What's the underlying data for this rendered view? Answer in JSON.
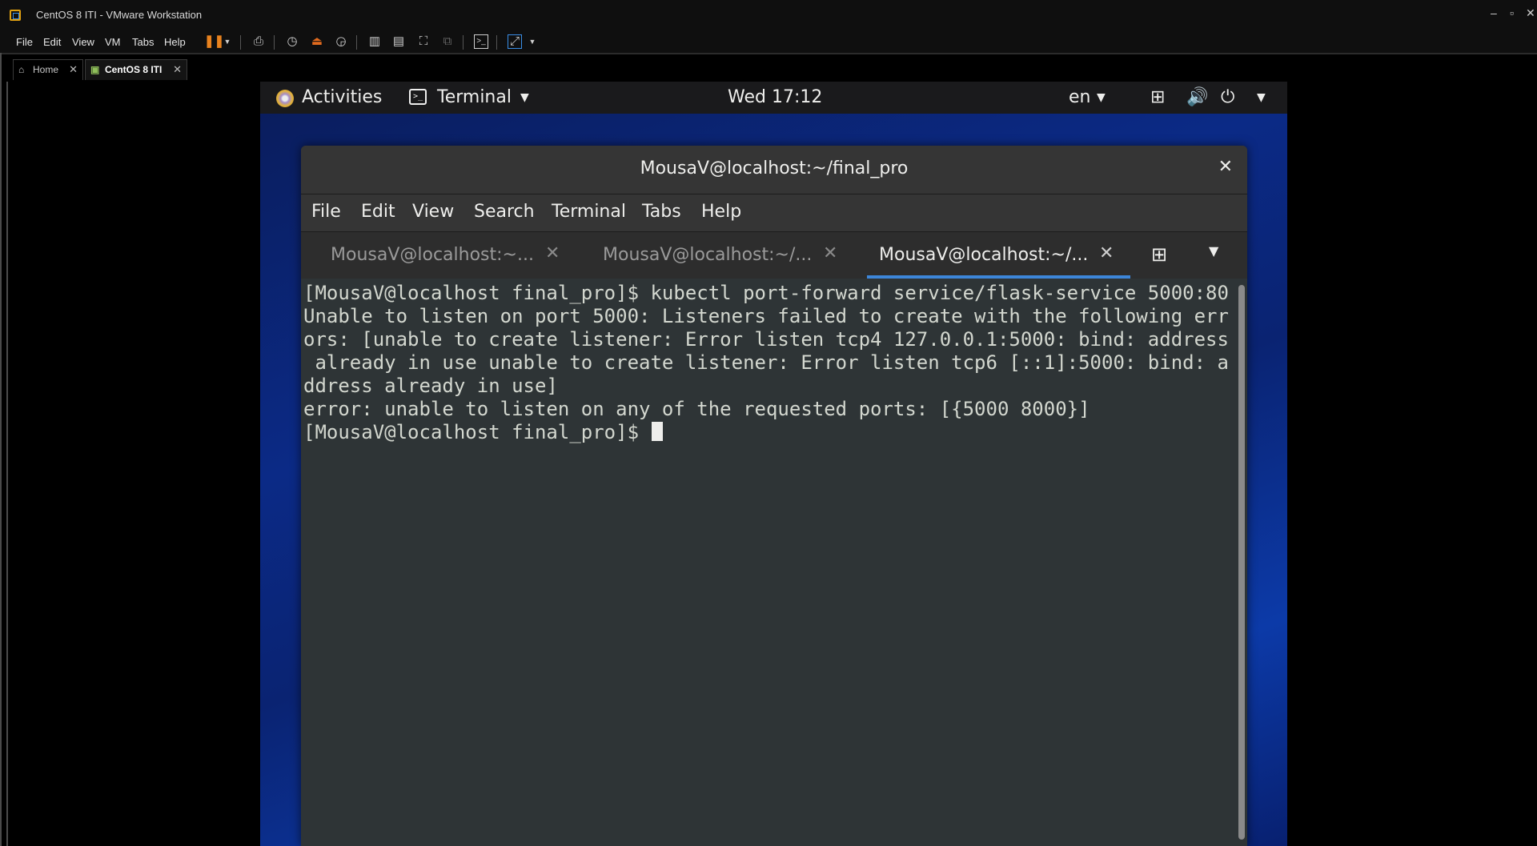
{
  "vmware": {
    "window_title": "CentOS 8 ITI - VMware Workstation",
    "menu": [
      "File",
      "Edit",
      "View",
      "VM",
      "Tabs",
      "Help"
    ],
    "window_controls": {
      "minimize": "–",
      "restore": "▫",
      "close": "✕"
    },
    "tabs": [
      {
        "label": "Home",
        "icon": "home-icon",
        "close": "✕"
      },
      {
        "label": "CentOS 8 ITI",
        "icon": "vm-icon",
        "close": "✕",
        "active": true
      }
    ],
    "accent_color": "#e8821e"
  },
  "gnome": {
    "activities_label": "Activities",
    "app_menu_label": "Terminal",
    "clock": "Wed 17:12",
    "language": "en",
    "status_icons": [
      "network-icon",
      "volume-icon",
      "power-icon"
    ]
  },
  "terminal": {
    "window_title": "MousaV@localhost:~/final_pro",
    "close_glyph": "✕",
    "menu": [
      "File",
      "Edit",
      "View",
      "Search",
      "Terminal",
      "Tabs",
      "Help"
    ],
    "tabs": [
      {
        "label": "MousaV@localhost:~...",
        "close": "✕",
        "active": false
      },
      {
        "label": "MousaV@localhost:~/...",
        "close": "✕",
        "active": false
      },
      {
        "label": "MousaV@localhost:~/...",
        "close": "✕",
        "active": true
      }
    ],
    "output_lines": [
      "[MousaV@localhost final_pro]$ kubectl port-forward service/flask-service 5000:80",
      "Unable to listen on port 5000: Listeners failed to create with the following err",
      "ors: [unable to create listener: Error listen tcp4 127.0.0.1:5000: bind: address",
      " already in use unable to create listener: Error listen tcp6 [::1]:5000: bind: a",
      "ddress already in use]",
      "error: unable to listen on any of the requested ports: [{5000 8000}]"
    ],
    "prompt": "[MousaV@localhost final_pro]$ ",
    "accent_color": "#3d86d9",
    "background_color": "#2e3436",
    "text_color": "#d3d7cf"
  }
}
